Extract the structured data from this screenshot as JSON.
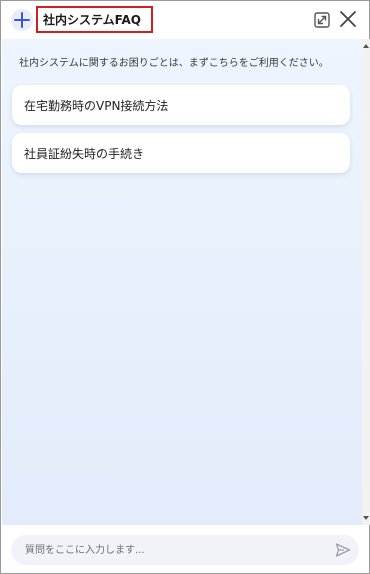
{
  "header": {
    "title": "社内システムFAQ",
    "icons": [
      "plus-icon",
      "expand-icon",
      "close-icon"
    ],
    "accent_color": "#3b57d6"
  },
  "chat": {
    "intro_message": "社内システムに関するお困りごとは、まずこちらをご利用ください。",
    "faq_items": [
      {
        "label": "在宅勤務時のVPN接続方法"
      },
      {
        "label": "社員証紛失時の手続き"
      }
    ]
  },
  "composer": {
    "placeholder": "質問をここに入力します...",
    "value": "",
    "send_icon": "send-icon"
  },
  "colors": {
    "title_highlight_border": "#d01f1f",
    "background_gradient_top": "#eef5fd",
    "background_gradient_bottom": "#e4ecfb"
  }
}
